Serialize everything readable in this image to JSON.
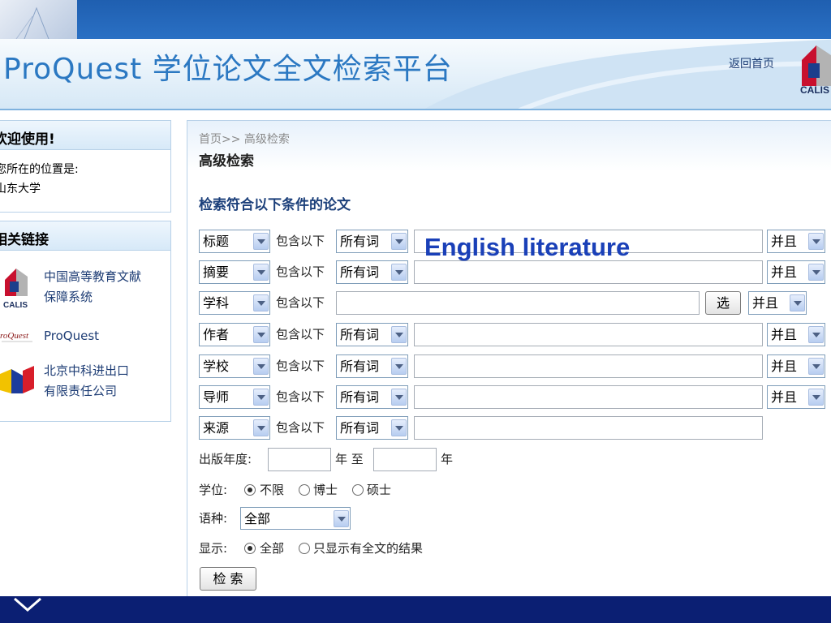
{
  "header": {
    "title": "ProQuest 学位论文全文检索平台",
    "return_link": "返回首页",
    "logo_text": "CALIS"
  },
  "sidebar": {
    "welcome_title": "欢迎使用!",
    "location_label": "您所在的位置是:",
    "location_value": "山东大学",
    "links_title": "相关链接",
    "links": [
      {
        "label_line1": "中国高等教育文献",
        "label_line2": "保障系统",
        "icon": "calis-icon"
      },
      {
        "label_line1": "ProQuest",
        "label_line2": "",
        "icon": "proquest-logo-icon"
      },
      {
        "label_line1": "北京中科进出口",
        "label_line2": "有限责任公司",
        "icon": "company-logo-icon"
      }
    ]
  },
  "main": {
    "breadcrumb": "首页>> 高级检索",
    "page_title": "高级检索",
    "section_title": "检索符合以下条件的论文",
    "contains_label": "包含以下",
    "rows": [
      {
        "field": "标题",
        "match": "所有词",
        "value": "",
        "logic": "并且"
      },
      {
        "field": "摘要",
        "match": "所有词",
        "value": "",
        "logic": "并且"
      },
      {
        "field": "学科",
        "match": "",
        "value": "",
        "logic": "并且",
        "select_button": "选"
      },
      {
        "field": "作者",
        "match": "所有词",
        "value": "",
        "logic": "并且"
      },
      {
        "field": "学校",
        "match": "所有词",
        "value": "",
        "logic": "并且"
      },
      {
        "field": "导师",
        "match": "所有词",
        "value": "",
        "logic": "并且"
      },
      {
        "field": "来源",
        "match": "所有词",
        "value": "",
        "logic": ""
      }
    ],
    "year": {
      "label": "出版年度:",
      "from_value": "",
      "mid_label": "年 至",
      "to_value": "",
      "end_label": "年"
    },
    "degree": {
      "label": "学位:",
      "options": [
        "不限",
        "博士",
        "硕士"
      ],
      "selected": "不限"
    },
    "language": {
      "label": "语种:",
      "value": "全部"
    },
    "display": {
      "label": "显示:",
      "options": [
        "全部",
        "只显示有全文的结果"
      ],
      "selected": "全部"
    },
    "search_button": "检 索"
  },
  "overlay_text": "English literature",
  "colors": {
    "accent": "#2b78c2",
    "link": "#1e3d75",
    "bottom_bar": "#0b1f73",
    "overlay": "#1a40b8"
  }
}
